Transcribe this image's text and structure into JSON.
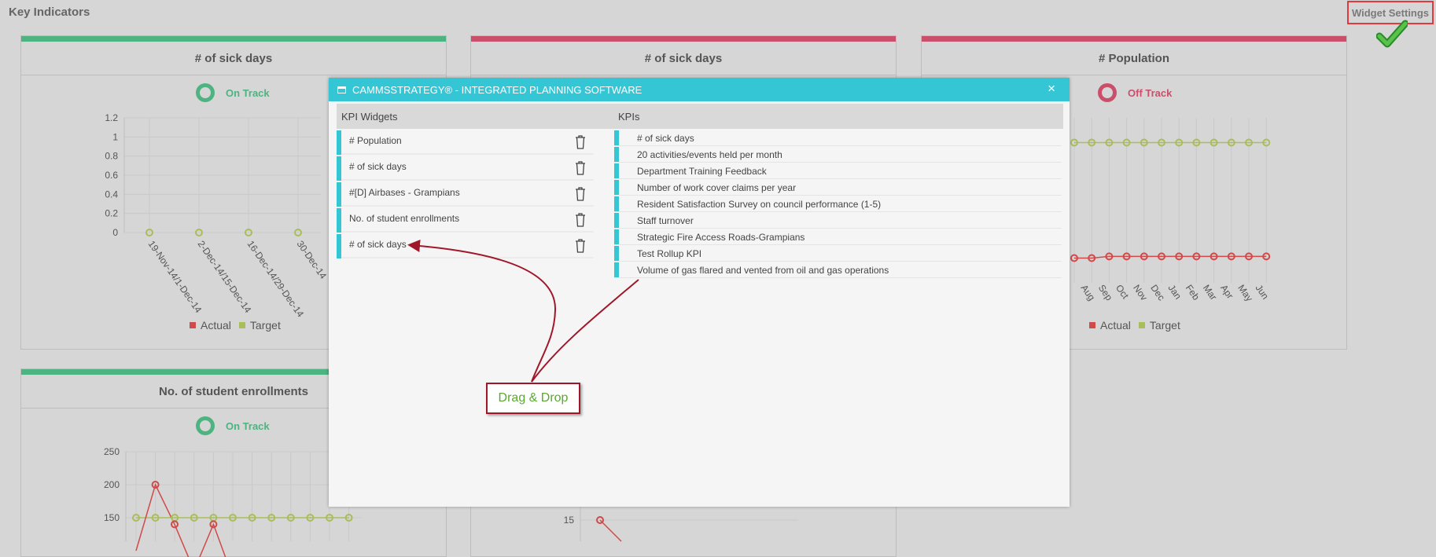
{
  "page": {
    "title": "Key Indicators"
  },
  "widget_settings": {
    "label": "Widget Settings"
  },
  "colors": {
    "on_track": "#4db380",
    "off_track": "#c94f6a",
    "actual": "#d04a4a",
    "target": "#a9bd5a",
    "modal_header": "#35c6d6",
    "annotation": "#a0172a",
    "drag_drop_text": "#5aa831"
  },
  "widgets": [
    {
      "title": "# of sick days",
      "status": "On Track"
    },
    {
      "title": "# of sick days"
    },
    {
      "title": "# Population",
      "status": "Off Track"
    },
    {
      "title": "No. of student enrollments",
      "status": "On Track"
    }
  ],
  "legend": {
    "actual": "Actual",
    "target": "Target"
  },
  "chart_data": [
    {
      "type": "line",
      "title": "# of sick days",
      "categories": [
        "19-Nov-14/1-Dec-14",
        "2-Dec-14/15-Dec-14",
        "16-Dec-14/29-Dec-14",
        "30-Dec-14"
      ],
      "y_ticks": [
        "1.2",
        "1",
        "0.8",
        "0.6",
        "0.4",
        "0.2",
        "0"
      ],
      "ylim": [
        0,
        1.2
      ],
      "series": [
        {
          "name": "Actual",
          "values": []
        },
        {
          "name": "Target",
          "values": [
            0,
            0,
            0,
            0
          ]
        }
      ],
      "grid": true,
      "legend_position": "bottom"
    },
    {
      "type": "line",
      "title": "# Population",
      "categories": [
        "Aug",
        "Sep",
        "Oct",
        "Nov",
        "Dec",
        "Jan",
        "Feb",
        "Mar",
        "Apr",
        "May",
        "Jun"
      ],
      "series": [
        {
          "name": "Actual",
          "values": [
            0.15,
            0.15,
            0.16,
            0.16,
            0.16,
            0.16,
            0.16,
            0.16,
            0.16,
            0.16,
            0.16,
            0.16
          ]
        },
        {
          "name": "Target",
          "values": [
            0.85,
            0.85,
            0.85,
            0.85,
            0.85,
            0.85,
            0.85,
            0.85,
            0.85,
            0.85,
            0.85,
            0.85
          ]
        }
      ],
      "grid": true,
      "legend_position": "bottom"
    },
    {
      "type": "line",
      "title": "No. of student enrollments",
      "y_ticks": [
        "250",
        "200",
        "150"
      ],
      "series": [
        {
          "name": "Actual",
          "values": [
            100,
            200,
            140,
            70,
            140,
            60
          ]
        },
        {
          "name": "Target",
          "values": [
            150,
            150,
            150,
            150,
            150,
            150,
            150,
            150,
            150,
            150,
            150,
            150
          ]
        }
      ],
      "grid": true
    },
    {
      "type": "line",
      "y_ticks": [
        "15"
      ],
      "series": [
        {
          "name": "Actual",
          "values": [
            15,
            12
          ]
        }
      ],
      "grid": true
    }
  ],
  "modal": {
    "title": "CAMMSSTRATEGY® - INTEGRATED PLANNING SOFTWARE",
    "close": "×",
    "kpi_widgets_header": "KPI Widgets",
    "kpis_header": "KPIs",
    "kpi_widgets": [
      "# Population",
      "# of sick days",
      "#[D] Airbases - Grampians",
      "No. of student enrollments",
      "# of sick days"
    ],
    "kpis": [
      "# of sick days",
      "20 activities/events held per month",
      "Department Training Feedback",
      "Number of work cover claims per year",
      "Resident Satisfaction Survey on council performance (1-5)",
      "Staff turnover",
      "Strategic Fire Access Roads-Grampians",
      "Test Rollup KPI",
      "Volume of gas flared and vented from oil and gas operations"
    ]
  },
  "annotation": {
    "label": "Drag & Drop"
  }
}
